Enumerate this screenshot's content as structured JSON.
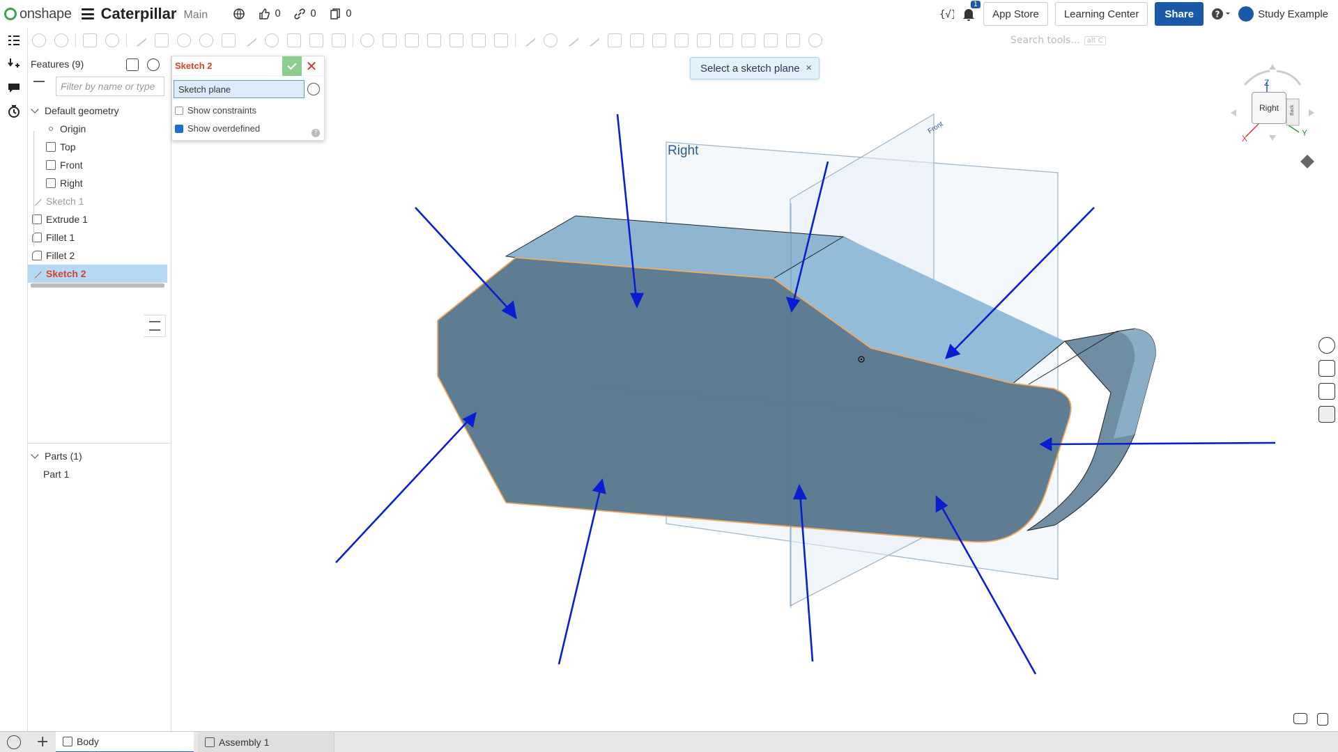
{
  "app": {
    "brand": "onshape",
    "document_title": "Caterpillar",
    "branch": "Main",
    "likes": "0",
    "links": "0",
    "copies": "0",
    "notification_count": "1",
    "app_store": "App Store",
    "learning_center": "Learning Center",
    "share": "Share",
    "user": "Study Example"
  },
  "toolbar": {
    "search_placeholder": "Search tools...",
    "search_shortcut": "alt C"
  },
  "features": {
    "header": "Features (9)",
    "filter_placeholder": "Filter by name or type",
    "default_geometry": "Default geometry",
    "items": [
      {
        "label": "Origin"
      },
      {
        "label": "Top"
      },
      {
        "label": "Front"
      },
      {
        "label": "Right"
      },
      {
        "label": "Sketch 1"
      },
      {
        "label": "Extrude 1"
      },
      {
        "label": "Fillet 1"
      },
      {
        "label": "Fillet 2"
      },
      {
        "label": "Sketch 2"
      }
    ],
    "parts_header": "Parts (1)",
    "part": "Part 1"
  },
  "sketch_dialog": {
    "title": "Sketch 2",
    "plane_field": "Sketch plane",
    "show_constraints": "Show constraints",
    "show_overdefined": "Show overdefined",
    "help": "?"
  },
  "toast": {
    "message": "Select a sketch plane",
    "close": "×"
  },
  "viewport": {
    "plane_label_right": "Right",
    "plane_label_front": "Front"
  },
  "viewcube": {
    "face": "Right",
    "side_face": "Back",
    "z": "Z",
    "y": "Y",
    "x": "X"
  },
  "bottom": {
    "tabs": [
      {
        "label": "Body"
      },
      {
        "label": "Assembly 1"
      }
    ]
  },
  "colors": {
    "accent": "#1a58a8",
    "selected_feature": "#d5412a",
    "part_side": "#5f7d92",
    "part_top": "#8fb6d0",
    "arrow": "#0a1ed0"
  }
}
